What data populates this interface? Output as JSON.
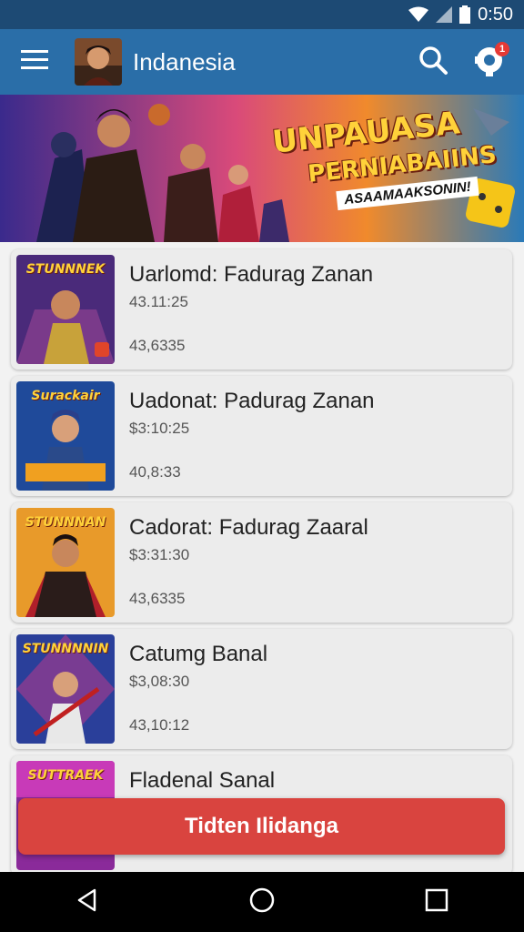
{
  "status": {
    "time": "0:50"
  },
  "app_bar": {
    "title": "Indanesia",
    "notification_count": "1"
  },
  "banner": {
    "line1": "UNPAUASA",
    "line2": "PERNIABAIINS",
    "line3": "ASAAMAAKSONIN!"
  },
  "items": [
    {
      "title": "Uarlomd: Fadurag Zanan",
      "time": "43.11:25",
      "count": "43,6335",
      "thumb_label": "STUNNNEK"
    },
    {
      "title": "Uadonat: Padurag Zanan",
      "time": "$3:10:25",
      "count": "40,8:33",
      "thumb_label": "Surackair"
    },
    {
      "title": "Cadorat: Fadurag Zaaral",
      "time": "$3:31:30",
      "count": "43,6335",
      "thumb_label": "STUNNNAN"
    },
    {
      "title": "Catumg Banal",
      "time": "$3,08:30",
      "count": "43,10:12",
      "thumb_label": "STUNNNNIN"
    },
    {
      "title": "Fladenal Sanal",
      "time": "",
      "count": "",
      "thumb_label": "SUTTRAEK"
    }
  ],
  "cta": {
    "label": "Tidten Ilidanga"
  },
  "colors": {
    "app_bar": "#2a6ea8",
    "status_bar": "#1d4a74",
    "cta": "#d9443f"
  },
  "icons": [
    "menu-icon",
    "search-icon",
    "game-controller-icon",
    "back-icon",
    "home-icon",
    "recents-icon"
  ]
}
